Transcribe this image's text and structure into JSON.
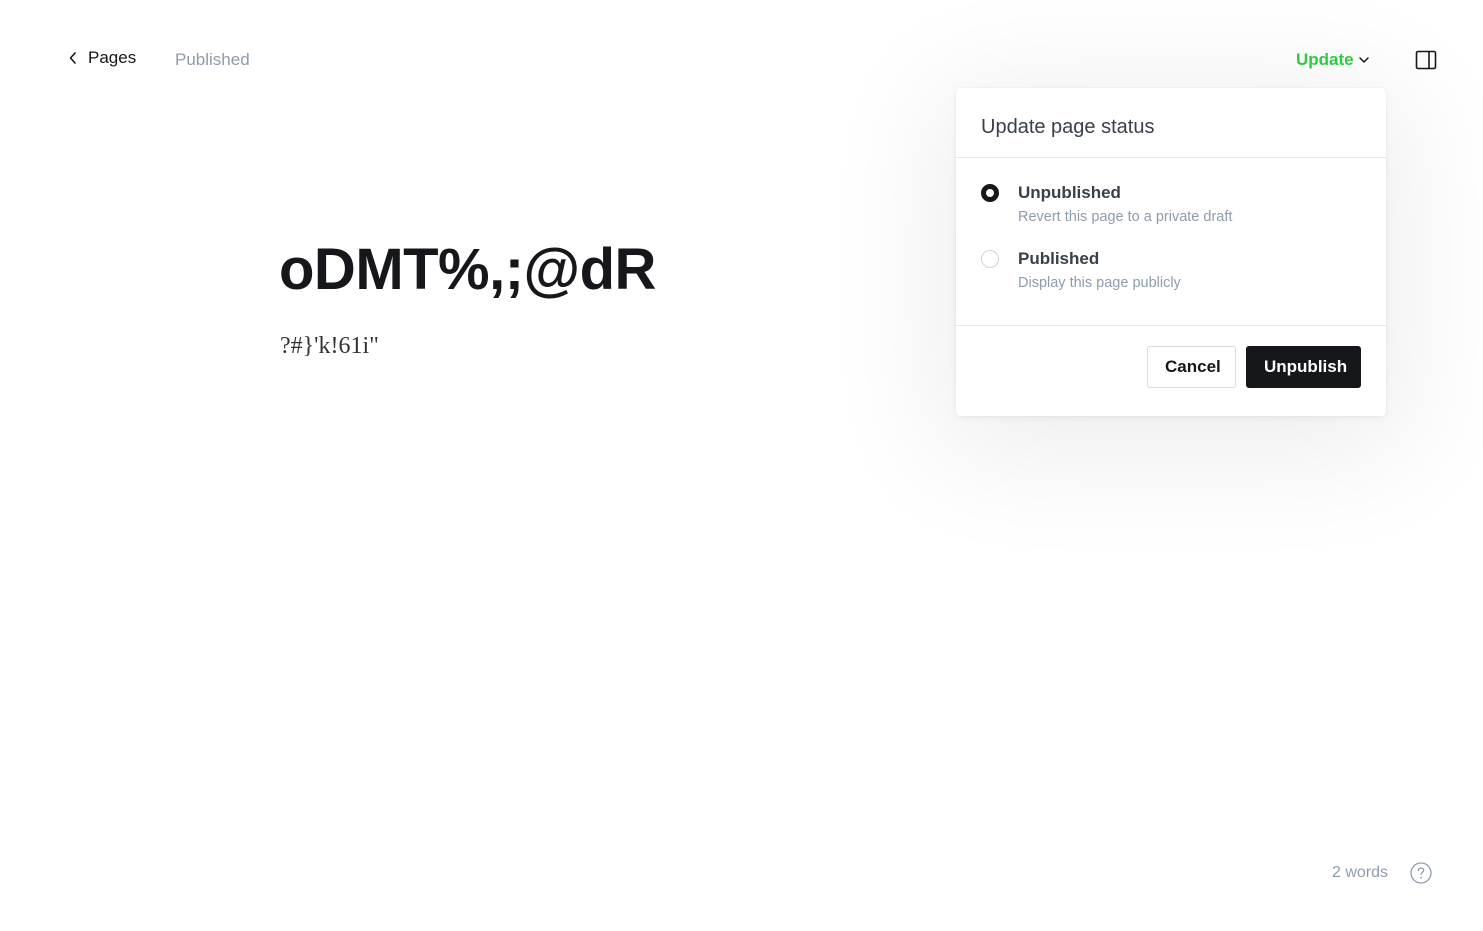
{
  "header": {
    "back_label": "Pages",
    "status": "Published",
    "update_label": "Update",
    "icons": {
      "back": "chevron-left-icon",
      "update_caret": "chevron-down-icon",
      "sidebar": "sidebar-toggle-icon"
    },
    "accent_color": "#30cf43"
  },
  "editor": {
    "title": "oDMT%,;@dR",
    "body": "?#}'k!61i\""
  },
  "popover": {
    "title": "Update page status",
    "options": [
      {
        "label": "Unpublished",
        "description": "Revert this page to a private draft",
        "selected": true
      },
      {
        "label": "Published",
        "description": "Display this page publicly",
        "selected": false
      }
    ],
    "cancel_label": "Cancel",
    "confirm_label": "Unpublish"
  },
  "footer": {
    "word_count": "2 words",
    "help_icon": "help-circle-icon"
  }
}
